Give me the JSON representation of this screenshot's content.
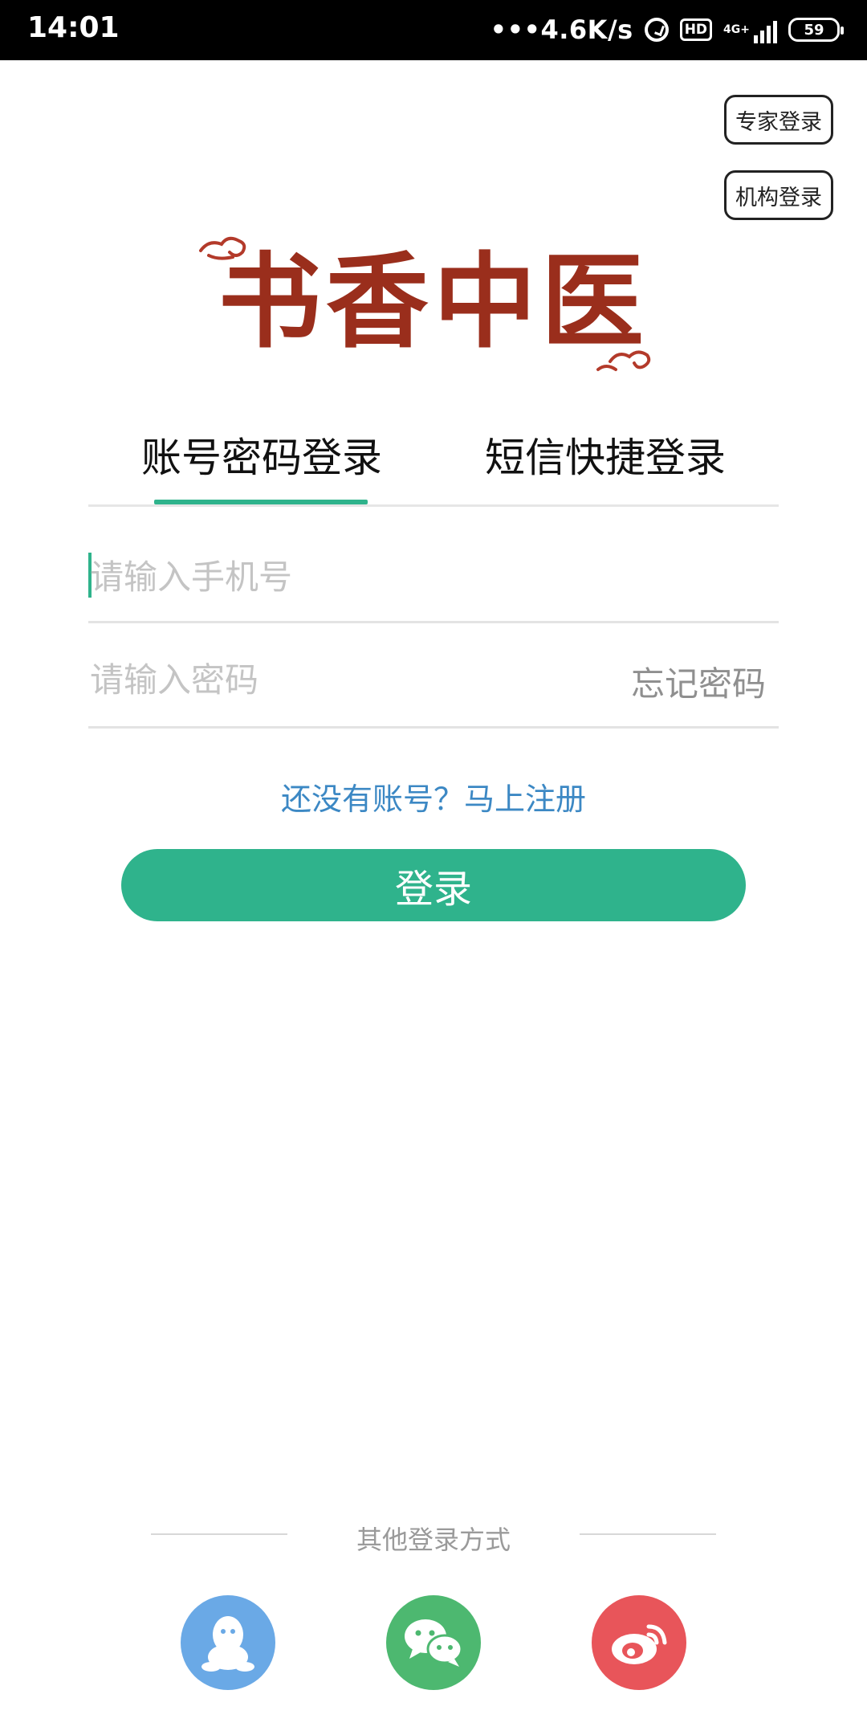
{
  "status_bar": {
    "time": "14:01",
    "speed": "•••4.6K/s",
    "hd": "HD",
    "network": "4G+",
    "battery": "59"
  },
  "corner_buttons": {
    "expert_login": "专家登录",
    "institution_login": "机构登录"
  },
  "logo": {
    "text": "书香中医"
  },
  "tabs": {
    "account_password": "账号密码登录",
    "sms_quick": "短信快捷登录",
    "active": "account_password"
  },
  "form": {
    "phone_placeholder": "请输入手机号",
    "password_placeholder": "请输入密码",
    "forgot_password": "忘记密码",
    "register_prompt": "还没有账号？马上注册",
    "login_button": "登录"
  },
  "other_login": {
    "title": "其他登录方式",
    "providers": [
      "qq-icon",
      "wechat-icon",
      "weibo-icon"
    ]
  },
  "colors": {
    "accent": "#2fb38c",
    "link": "#3c88c4",
    "qq": "#6aa9e6",
    "wechat": "#4db870",
    "weibo": "#e8555a"
  }
}
